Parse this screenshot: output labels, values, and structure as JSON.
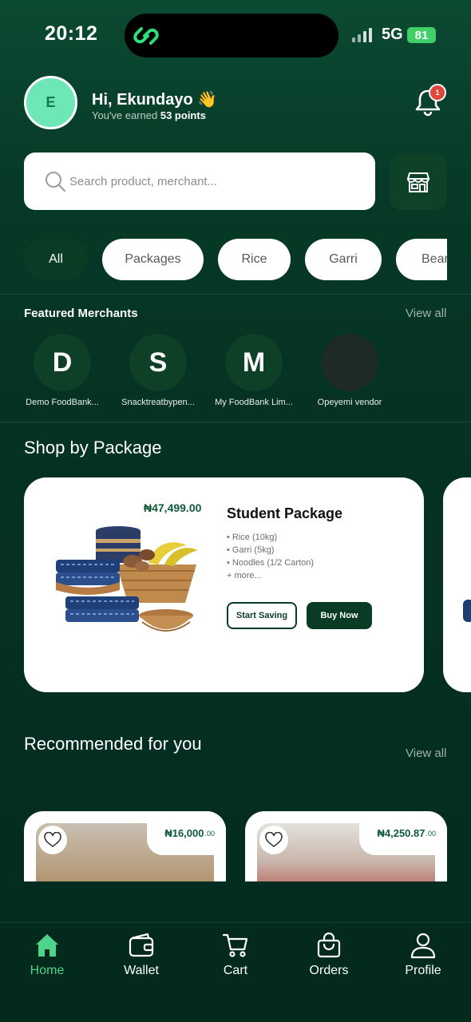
{
  "status_bar": {
    "time": "20:12",
    "network": "5G",
    "battery": "81"
  },
  "header": {
    "avatar_initial": "E",
    "greeting": "Hi, Ekundayo 👋",
    "earned_prefix": "You've earned ",
    "points": "53 points",
    "notification_count": "1"
  },
  "search": {
    "placeholder": "Search product, merchant..."
  },
  "categories": [
    "All",
    "Packages",
    "Rice",
    "Garri",
    "Bean"
  ],
  "featured": {
    "title": "Featured Merchants",
    "view_all": "View all",
    "merchants": [
      {
        "initial": "D",
        "name": "Demo FoodBank..."
      },
      {
        "initial": "S",
        "name": "Snacktreatbypen..."
      },
      {
        "initial": "M",
        "name": "My FoodBank Lim..."
      },
      {
        "initial": "",
        "name": "Opeyemi vendor"
      }
    ]
  },
  "shop_by_package": {
    "title": "Shop by Package",
    "package": {
      "price": "₦47,499.00",
      "name": "Student Package",
      "items": [
        "• Rice (10kg)",
        "• Garri (5kg)",
        "• Noodles (1/2 Carton)",
        "+ more..."
      ],
      "start_saving": "Start Saving",
      "buy_now": "Buy Now"
    }
  },
  "recommended": {
    "title": "Recommended for you",
    "view_all": "View all",
    "products": [
      {
        "price_main": "₦16,000",
        "price_decimal": ".00"
      },
      {
        "price_main": "₦4,250.87",
        "price_decimal": ".00"
      }
    ]
  },
  "bottom_nav": {
    "active": "Home",
    "items": [
      "Home",
      "Wallet",
      "Cart",
      "Orders",
      "Profile"
    ]
  },
  "colors": {
    "brand_dark": "#0a3c25",
    "accent_green": "#4ed38a",
    "avatar_bg": "#6ee7b7",
    "badge_red": "#e0463c"
  }
}
